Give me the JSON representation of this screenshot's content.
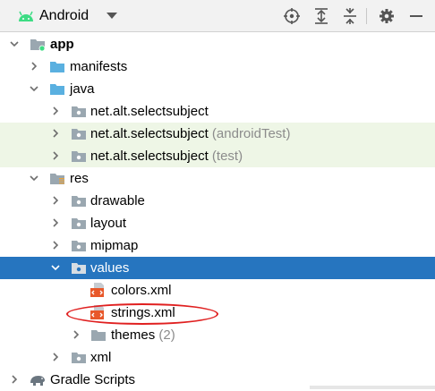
{
  "toolbar": {
    "title": "Android",
    "icons": [
      "android-icon",
      "crosshair-icon",
      "expand-all-icon",
      "collapse-all-icon",
      "gear-icon",
      "minimize-icon"
    ]
  },
  "tree": {
    "app": "app",
    "manifests": "manifests",
    "java": "java",
    "pkg_main": "net.alt.selectsubject",
    "pkg_android_test": "net.alt.selectsubject",
    "pkg_android_test_suffix": " (androidTest)",
    "pkg_test": "net.alt.selectsubject",
    "pkg_test_suffix": " (test)",
    "res": "res",
    "drawable": "drawable",
    "layout": "layout",
    "mipmap": "mipmap",
    "values": "values",
    "colors_xml": "colors.xml",
    "strings_xml": "strings.xml",
    "themes": "themes",
    "themes_count": " (2)",
    "xml": "xml",
    "gradle_scripts": "Gradle Scripts"
  },
  "colors": {
    "selection": "#2675bf",
    "alt_row": "#eef6e6",
    "annotation": "#e02020",
    "android_green": "#3ddc84"
  }
}
